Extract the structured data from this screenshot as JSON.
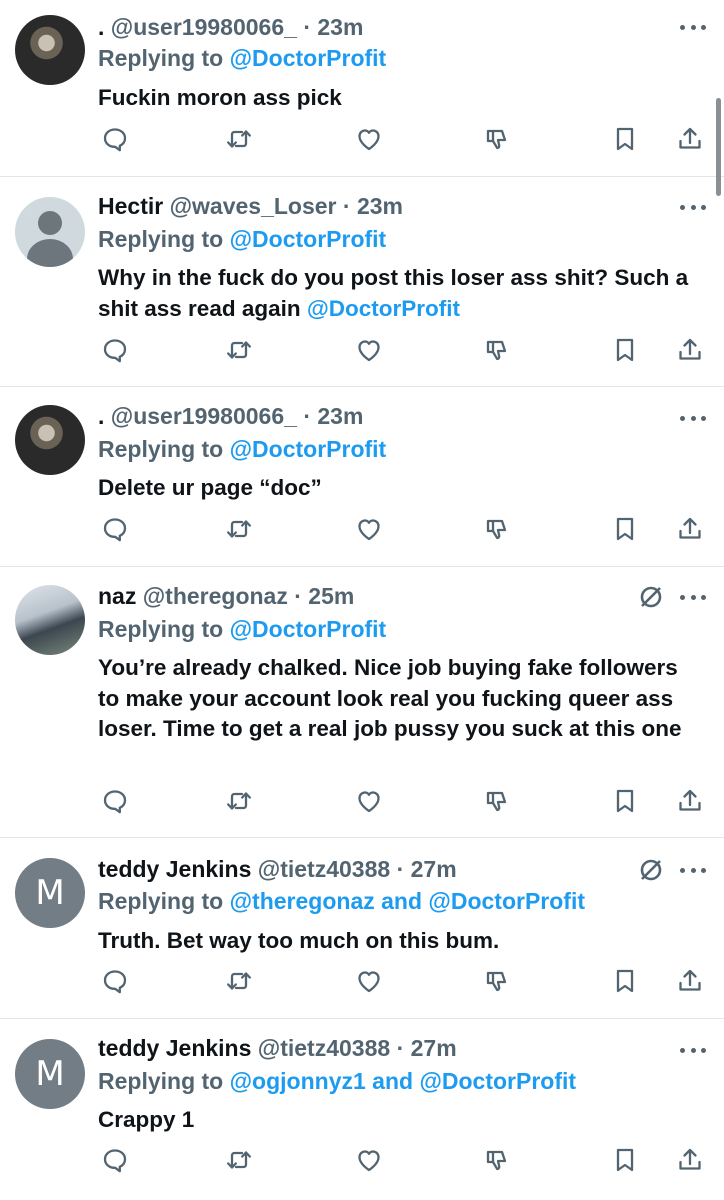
{
  "colors": {
    "link": "#1d9bf0",
    "muted": "#536471",
    "text": "#0f1419",
    "divider": "#e3e6e9"
  },
  "icons": {
    "reply": "reply-icon",
    "retweet": "retweet-icon",
    "like": "heart-icon",
    "downvote": "thumbs-down-icon",
    "bookmark": "bookmark-icon",
    "share": "share-icon",
    "more": "more-options-icon",
    "blocked": "slashed-circle-icon"
  },
  "tweets": [
    {
      "name": ".",
      "handle": "@user19980066_",
      "time": "· 23m",
      "reply_prefix": "Replying to",
      "reply_to": "@DoctorProfit",
      "text": "Fuckin moron ass pick",
      "avatar": "photo"
    },
    {
      "name": "Hectir",
      "handle": "@waves_Loser",
      "time": "· 23m",
      "reply_prefix": "Replying to",
      "reply_to": "@DoctorProfit",
      "text": "Why in the fuck do you post this loser ass shit? Such a shit ass read again",
      "text_mention": "@DoctorProfit",
      "avatar": "default"
    },
    {
      "name": ".",
      "handle": "@user19980066_",
      "time": "· 23m",
      "reply_prefix": "Replying to",
      "reply_to": "@DoctorProfit",
      "text": "Delete ur page “doc”",
      "avatar": "photo"
    },
    {
      "name": "naz",
      "handle": "@theregonaz",
      "time": "· 25m",
      "reply_prefix": "Replying to",
      "reply_to": "@DoctorProfit",
      "text": "You’re already chalked. Nice job buying fake followers to make your account look real you fucking queer ass loser. Time to get a real job pussy you suck at this one",
      "avatar": "photo2"
    },
    {
      "name": "teddy Jenkins",
      "handle": "@tietz40388",
      "time": "· 27m",
      "reply_prefix": "Replying to",
      "reply_to": "@theregonaz and @DoctorProfit",
      "text": "Truth. Bet way too much on this bum.",
      "avatar": "letter",
      "avatar_letter": "M"
    },
    {
      "name": "teddy Jenkins",
      "handle": "@tietz40388",
      "time": "· 27m",
      "reply_prefix": "Replying to",
      "reply_to": "@ogjonnyz1 and @DoctorProfit",
      "text": "Crappy 1",
      "avatar": "letter",
      "avatar_letter": "M"
    }
  ]
}
